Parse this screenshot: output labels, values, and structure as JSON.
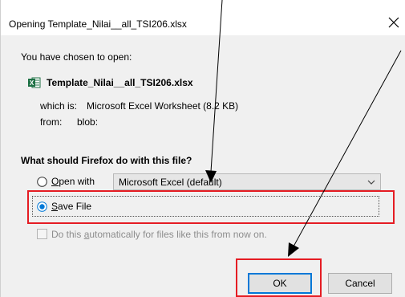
{
  "window": {
    "title": "Opening Template_Nilai__all_TSI206.xlsx",
    "close_glyph": "✕"
  },
  "dialog": {
    "chosen_label": "You have chosen to open:",
    "file_name": "Template_Nilai__all_TSI206.xlsx",
    "file_icon": "excel-file-icon",
    "which_is_label": "which is:",
    "which_is_value": "Microsoft Excel Worksheet (8.2 KB)",
    "from_label": "from:",
    "from_value": "blob:",
    "question": "What should Firefox do with this file?"
  },
  "options": {
    "open_with": {
      "label_mnemonic": "O",
      "label_rest": "pen with",
      "selected": false,
      "app_selected": "Microsoft Excel (default)"
    },
    "save_file": {
      "label_mnemonic": "S",
      "label_rest": "ave File",
      "selected": true
    },
    "auto": {
      "label_prefix": "Do this ",
      "label_mnemonic": "a",
      "label_rest": "utomatically for files like this from now on.",
      "checked": false,
      "disabled": true
    }
  },
  "buttons": {
    "ok": "OK",
    "cancel": "Cancel"
  },
  "annotations": {
    "highlight_color": "#e51c23",
    "arrow_color": "#000000"
  }
}
